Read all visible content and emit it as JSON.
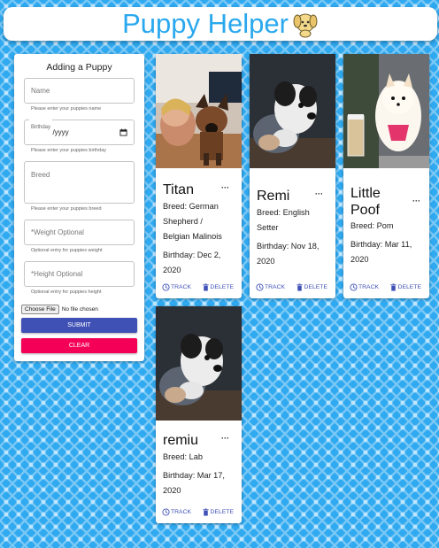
{
  "header": {
    "title": "Puppy Helper",
    "logo_icon": "puppy-face-icon"
  },
  "form": {
    "title": "Adding a Puppy",
    "name_placeholder": "Name",
    "name_helper": "Please enter your puppies name",
    "birthday_label": "Birthday",
    "birthday_value": "mm/dd/yyyy",
    "birthday_helper": "Please enter your puppies birthday",
    "breed_placeholder": "Breed",
    "breed_helper": "Please enter your puppies breed",
    "weight_placeholder": "*Weight Optional",
    "weight_helper": "Optional entry for puppies weight",
    "height_placeholder": "*Height Optional",
    "height_helper": "Optional entry for puppies height",
    "file_button": "Choose File",
    "file_status": "No file chosen",
    "submit_label": "SUBMIT",
    "clear_label": "CLEAR"
  },
  "cards": [
    {
      "name": "Titan",
      "breed_lines": [
        "Breed: German",
        "Shepherd /",
        "Belgian Malinois"
      ],
      "birthday_lines": [
        "Birthday: Dec 2,",
        "2020"
      ],
      "track": "TRACK",
      "delete": "DELETE",
      "more": "···"
    },
    {
      "name": "Remi",
      "breed_lines": [
        "Breed: English",
        "Setter"
      ],
      "birthday_lines": [
        "Birthday: Nov 18,",
        "2020"
      ],
      "track": "TRACK",
      "delete": "DELETE",
      "more": "···"
    },
    {
      "name_lines": [
        "Little",
        "Poof"
      ],
      "breed_lines": [
        "Breed: Pom"
      ],
      "birthday_lines": [
        "Birthday: Mar 11,",
        "2020"
      ],
      "track": "TRACK",
      "delete": "DELETE",
      "more": "···"
    },
    {
      "name": "remiu",
      "breed_lines": [
        "Breed: Lab"
      ],
      "birthday_lines": [
        "Birthday: Mar 17,",
        "2020"
      ],
      "track": "TRACK",
      "delete": "DELETE",
      "more": "···"
    }
  ],
  "colors": {
    "primary": "#3f51b5",
    "secondary": "#f50057",
    "title": "#2aa8ee",
    "background": "#2fa9f0"
  }
}
